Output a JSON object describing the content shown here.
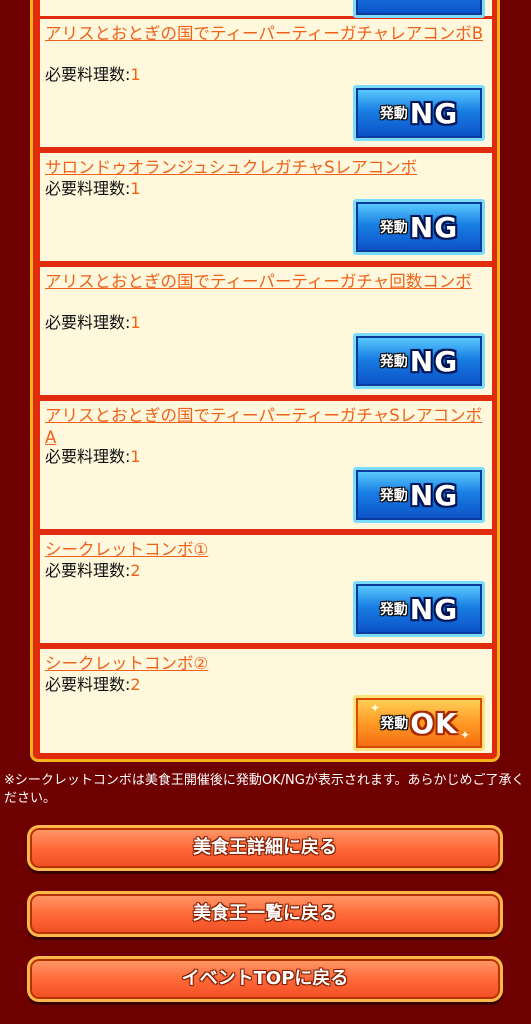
{
  "combos": [
    {
      "title": "アリスとおとぎの国でティーパーティーガチャレアコンボB",
      "req_label": "必要料理数:",
      "req_value": "1",
      "status_small": "発動",
      "status_big": "NG"
    },
    {
      "title": "サロンドゥオランジュシュクレガチャSレアコンボ",
      "req_label": "必要料理数:",
      "req_value": "1",
      "status_small": "発動",
      "status_big": "NG"
    },
    {
      "title": "アリスとおとぎの国でティーパーティーガチャ回数コンボ",
      "req_label": "必要料理数:",
      "req_value": "1",
      "status_small": "発動",
      "status_big": "NG"
    },
    {
      "title": "アリスとおとぎの国でティーパーティーガチャSレアコンボA",
      "req_label": "必要料理数:",
      "req_value": "1",
      "status_small": "発動",
      "status_big": "NG"
    },
    {
      "title": "シークレットコンボ①",
      "req_label": "必要料理数:",
      "req_value": "2",
      "status_small": "発動",
      "status_big": "NG"
    },
    {
      "title": "シークレットコンボ②",
      "req_label": "必要料理数:",
      "req_value": "2",
      "status_small": "発動",
      "status_big": "OK"
    }
  ],
  "note": "※シークレットコンボは美食王開催後に発動OK/NGが表示されます。あらかじめご了承ください。",
  "buttons": {
    "detail": "美食王詳細に戻る",
    "list": "美食王一覧に戻る",
    "top": "イベントTOPに戻る"
  },
  "colors": {
    "background": "#6e0000",
    "frame": "#e12b0f",
    "link": "#f0611a",
    "button": "#ff6a3a"
  }
}
